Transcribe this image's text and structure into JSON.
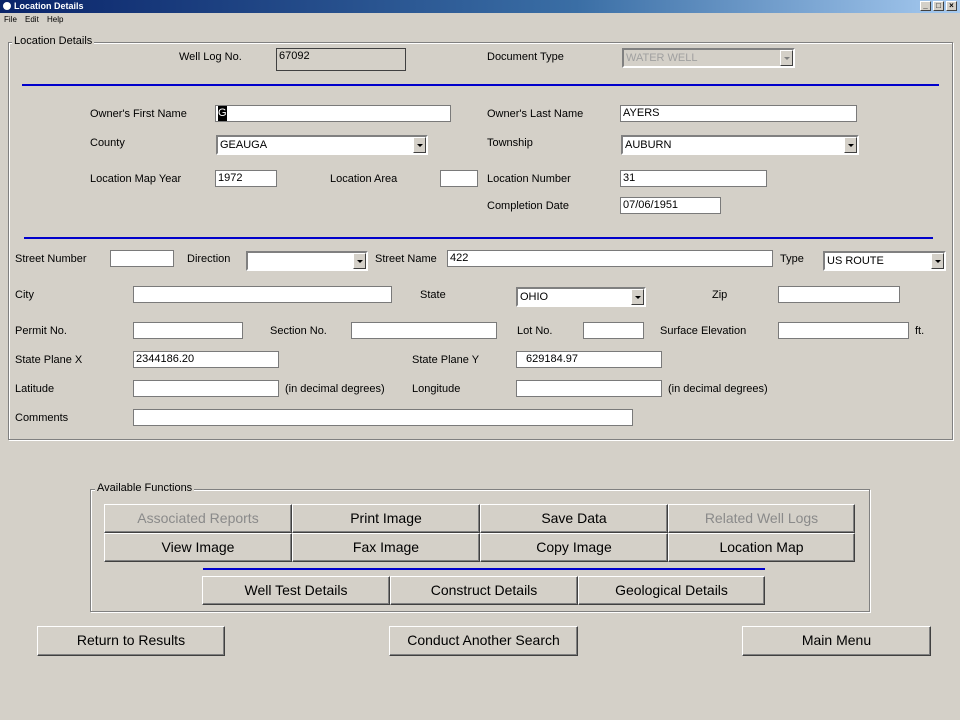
{
  "window": {
    "title": "Location Details"
  },
  "menu": [
    "File",
    "Edit",
    "Help"
  ],
  "location": {
    "legend": "Location Details",
    "well_log_no_label": "Well Log No.",
    "well_log_no": "67092",
    "document_type_label": "Document Type",
    "document_type": "WATER WELL",
    "owner_first_label": "Owner's First Name",
    "owner_first": "G",
    "owner_last_label": "Owner's Last Name",
    "owner_last": "AYERS",
    "county_label": "County",
    "county": "GEAUGA",
    "township_label": "Township",
    "township": "AUBURN",
    "map_year_label": "Location Map Year",
    "map_year": "1972",
    "area_label": "Location Area",
    "area": "",
    "loc_number_label": "Location Number",
    "loc_number": "31",
    "completion_label": "Completion Date",
    "completion": "07/06/1951",
    "street_number_label": "Street Number",
    "street_number": "",
    "direction_label": "Direction",
    "direction": "",
    "street_name_label": "Street Name",
    "street_name": "422",
    "type_label": "Type",
    "type": "US ROUTE",
    "city_label": "City",
    "city": "",
    "state_label": "State",
    "state": "OHIO",
    "zip_label": "Zip",
    "zip": "",
    "permit_label": "Permit No.",
    "permit": "",
    "section_label": "Section No.",
    "section": "",
    "lot_label": "Lot No.",
    "lot": "",
    "elevation_label": "Surface Elevation",
    "elevation": "",
    "elevation_unit": "ft.",
    "spx_label": "State Plane X",
    "spx": "2344186.20",
    "spy_label": "State Plane Y",
    "spy": "629184.97",
    "lat_label": "Latitude",
    "lat": "",
    "lat_hint": "(in decimal degrees)",
    "lon_label": "Longitude",
    "lon": "",
    "lon_hint": "(in decimal degrees)",
    "comments_label": "Comments",
    "comments": ""
  },
  "functions": {
    "legend": "Available Functions",
    "associated_reports": "Associated Reports",
    "print_image": "Print Image",
    "save_data": "Save Data",
    "related_well_logs": "Related Well Logs",
    "view_image": "View Image",
    "fax_image": "Fax Image",
    "copy_image": "Copy Image",
    "location_map": "Location Map",
    "well_test_details": "Well Test Details",
    "construct_details": "Construct Details",
    "geological_details": "Geological Details"
  },
  "nav": {
    "return": "Return to Results",
    "another_search": "Conduct Another Search",
    "main_menu": "Main Menu"
  },
  "colors": {
    "titlebar": "#0a246a",
    "divider": "#0000cc",
    "face": "#d4d0c8"
  }
}
